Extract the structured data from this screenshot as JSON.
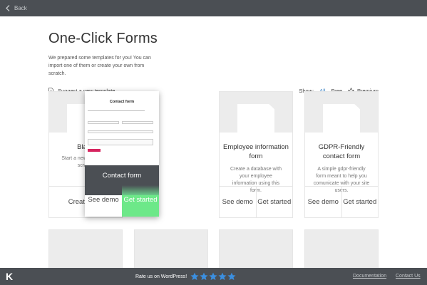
{
  "topbar": {
    "back_label": "Back"
  },
  "page": {
    "title": "One-Click Forms",
    "description": "We prepared some templates for you! You can import one of them or create your own from scratch."
  },
  "toolbar": {
    "suggest_label": "Suggest a new template",
    "show_label": "Show:",
    "filters": [
      "All",
      "Free",
      "Premium"
    ],
    "active_filter": "All"
  },
  "templates": [
    {
      "name": "Blank",
      "description": "Start a new form from scratch",
      "actions": [
        "Create new"
      ]
    },
    {
      "name": "Contact form",
      "preview_title": "Contact form",
      "actions": [
        "See demo",
        "Get started"
      ]
    },
    {
      "name": "Employee information form",
      "description": "Create a database with your employee information using this form.",
      "actions": [
        "See demo",
        "Get started"
      ]
    },
    {
      "name": "GDPR-Friendly contact form",
      "description": "A simple gdpr-friendly form meant to help you comunicate with your site users.",
      "actions": [
        "See demo",
        "Get started"
      ]
    }
  ],
  "footer": {
    "logo": "K",
    "rate_text": "Rate us on WordPress!",
    "stars": 5,
    "links": [
      "Documentation",
      "Contact Us"
    ]
  },
  "colors": {
    "accent": "#3b82c4",
    "bar": "#4b4f54",
    "get_started": "#6de889",
    "star": "#3b8fe0"
  }
}
